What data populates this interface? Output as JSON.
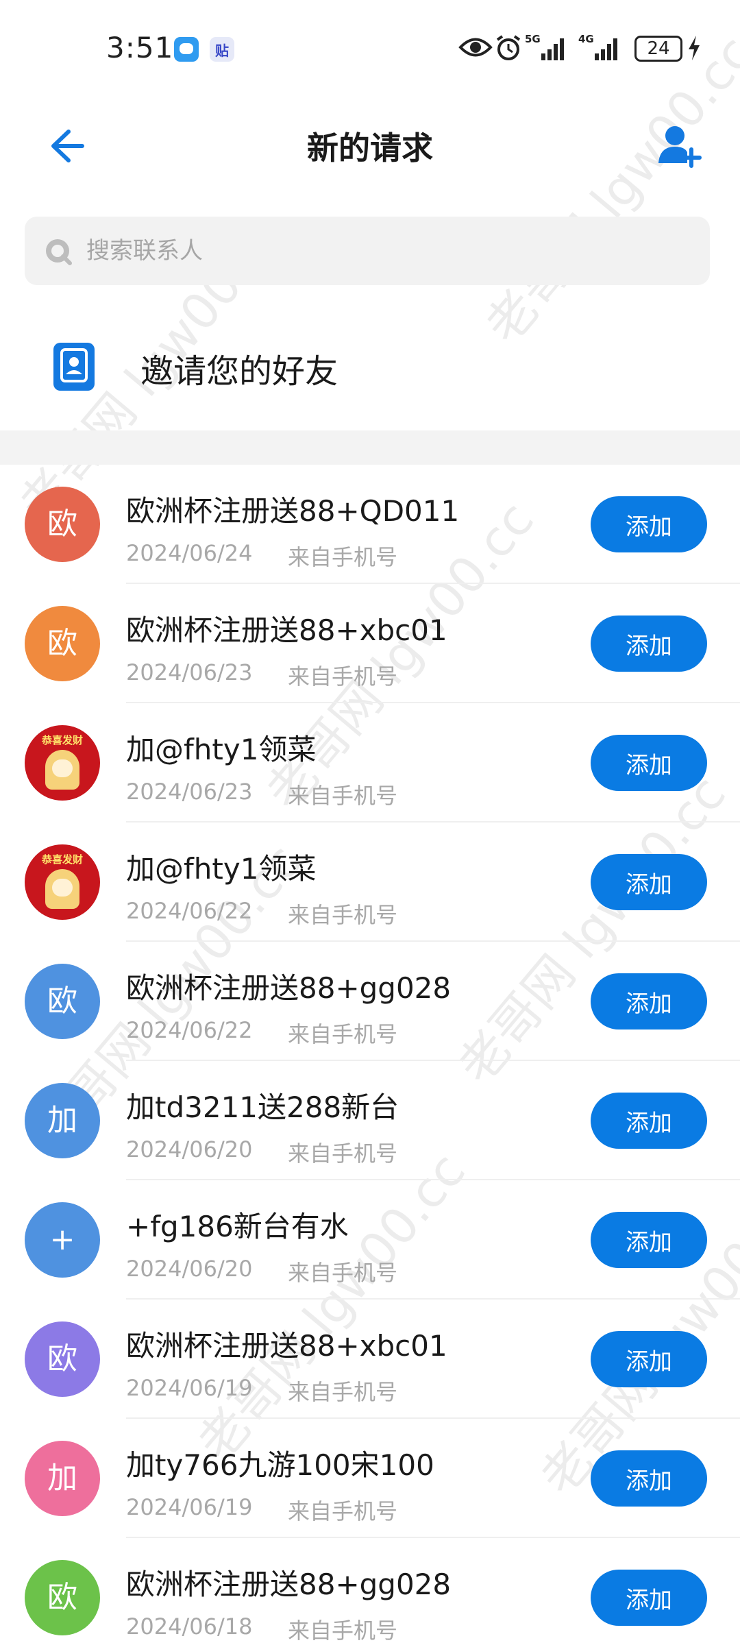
{
  "status_bar": {
    "time": "3:51",
    "notification_icons": [
      "message-icon",
      "tieba-icon"
    ],
    "tieba_glyph": "贴",
    "network_1": "5G",
    "network_2": "4G",
    "battery": "24"
  },
  "header": {
    "title": "新的请求",
    "back_icon": "arrow-left-icon",
    "add_contact_icon": "person-add-icon"
  },
  "search": {
    "placeholder": "搜索联系人"
  },
  "invite": {
    "label": "邀请您的好友",
    "icon": "contact-card-icon"
  },
  "requests": [
    {
      "avatar_text": "欧",
      "avatar_color": "#e5664e",
      "name": "欧洲杯注册送88+QD011",
      "date": "2024/06/24",
      "source": "来自手机号",
      "button": "添加"
    },
    {
      "avatar_text": "欧",
      "avatar_color": "#f08a3e",
      "name": "欧洲杯注册送88+xbc01",
      "date": "2024/06/23",
      "source": "来自手机号",
      "button": "添加"
    },
    {
      "avatar_text": "恭喜发财",
      "avatar_color": "#c8161d",
      "name": "加@fhty1领菜",
      "date": "2024/06/23",
      "source": "来自手机号",
      "button": "添加"
    },
    {
      "avatar_text": "恭喜发财",
      "avatar_color": "#c8161d",
      "name": "加@fhty1领菜",
      "date": "2024/06/22",
      "source": "来自手机号",
      "button": "添加"
    },
    {
      "avatar_text": "欧",
      "avatar_color": "#4f92e0",
      "name": "欧洲杯注册送88+gg028",
      "date": "2024/06/22",
      "source": "来自手机号",
      "button": "添加"
    },
    {
      "avatar_text": "加",
      "avatar_color": "#4f92e0",
      "name": "加td3211送288新台",
      "date": "2024/06/20",
      "source": "来自手机号",
      "button": "添加"
    },
    {
      "avatar_text": "+",
      "avatar_color": "#4f92e0",
      "name": "+fg186新台有水",
      "date": "2024/06/20",
      "source": "来自手机号",
      "button": "添加"
    },
    {
      "avatar_text": "欧",
      "avatar_color": "#8c7ae6",
      "name": "欧洲杯注册送88+xbc01",
      "date": "2024/06/19",
      "source": "来自手机号",
      "button": "添加"
    },
    {
      "avatar_text": "加",
      "avatar_color": "#ee6f9c",
      "name": "加ty766九游100宋100",
      "date": "2024/06/19",
      "source": "来自手机号",
      "button": "添加"
    },
    {
      "avatar_text": "欧",
      "avatar_color": "#6cc24a",
      "name": "欧洲杯注册送88+gg028",
      "date": "2024/06/18",
      "source": "来自手机号",
      "button": "添加"
    }
  ],
  "watermark": "老哥网 lgw00.cc"
}
